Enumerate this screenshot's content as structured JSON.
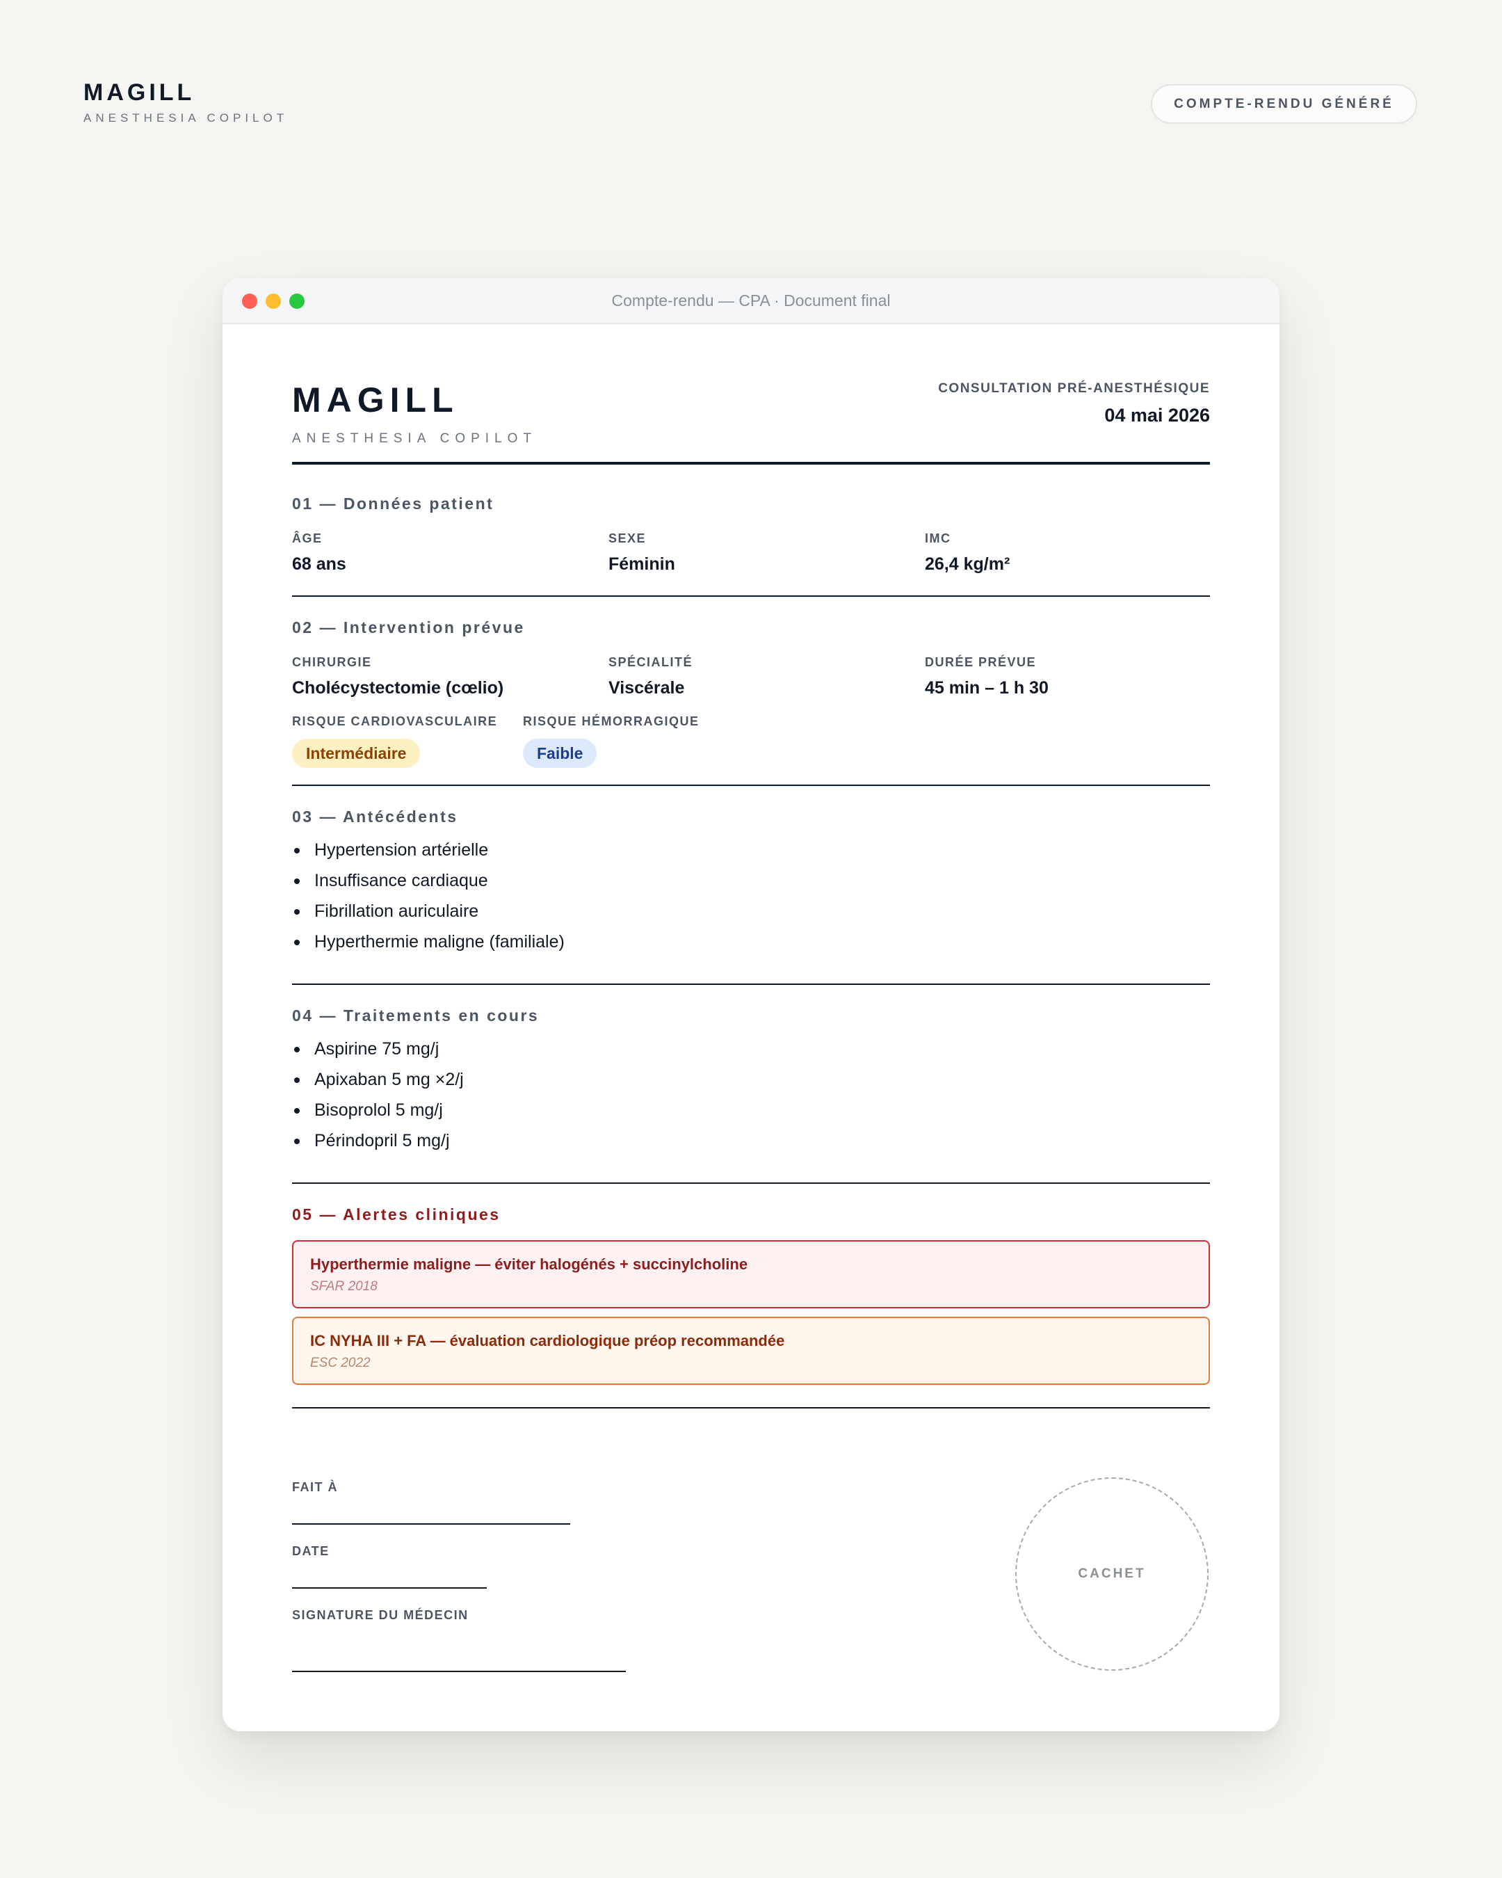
{
  "app": {
    "name": "MAGILL",
    "tagline": "ANESTHESIA COPILOT",
    "status_badge": "COMPTE-RENDU GÉNÉRÉ"
  },
  "window": {
    "title": "Compte-rendu — CPA · Document final"
  },
  "document": {
    "brand": "MAGILL",
    "tagline": "ANESTHESIA COPILOT",
    "kind": "CONSULTATION PRÉ-ANESTHÉSIQUE",
    "date": "04 mai 2026",
    "patient": {
      "title": "01 — Données patient",
      "fields": [
        {
          "label": "ÂGE",
          "value": "68 ans"
        },
        {
          "label": "SEXE",
          "value": "Féminin"
        },
        {
          "label": "IMC",
          "value": "26,4 kg/m²"
        }
      ]
    },
    "intervention": {
      "title": "02 — Intervention prévue",
      "fields": [
        {
          "label": "CHIRURGIE",
          "value": "Cholécystectomie (cœlio)"
        },
        {
          "label": "SPÉCIALITÉ",
          "value": "Viscérale"
        },
        {
          "label": "DURÉE PRÉVUE",
          "value": "45 min – 1 h 30"
        }
      ],
      "risks": [
        {
          "label": "RISQUE CARDIOVASCULAIRE",
          "value": "Intermédiaire"
        },
        {
          "label": "RISQUE HÉMORRAGIQUE",
          "value": "Faible"
        }
      ]
    },
    "history": {
      "title": "03 — Antécédents",
      "items": [
        "Hypertension artérielle",
        "Insuffisance cardiaque",
        "Fibrillation auriculaire",
        "Hyperthermie maligne (familiale)"
      ]
    },
    "treatments": {
      "title": "04 — Traitements en cours",
      "items": [
        "Aspirine 75 mg/j",
        "Apixaban 5 mg ×2/j",
        "Bisoprolol 5 mg/j",
        "Périndopril 5 mg/j"
      ]
    },
    "alerts": {
      "title": "05 — Alertes cliniques",
      "items": [
        {
          "message": "Hyperthermie maligne — éviter halogénés + succinylcholine",
          "source": "SFAR 2018",
          "level": "danger"
        },
        {
          "message": "IC NYHA III + FA — évaluation cardiologique préop recommandée",
          "source": "ESC 2022",
          "level": "warning"
        }
      ]
    },
    "signature": {
      "place_label": "FAIT À",
      "date_label": "DATE",
      "doctor_label": "SIGNATURE DU MÉDECIN",
      "stamp_label": "CACHET"
    }
  },
  "colors": {
    "background": "#f4f4f0",
    "ink": "#111827",
    "alert_danger": "#d32f3a",
    "alert_warning": "#e07a36",
    "risk_intermediate": "#fdf1c4",
    "risk_low": "#dce9fb"
  }
}
